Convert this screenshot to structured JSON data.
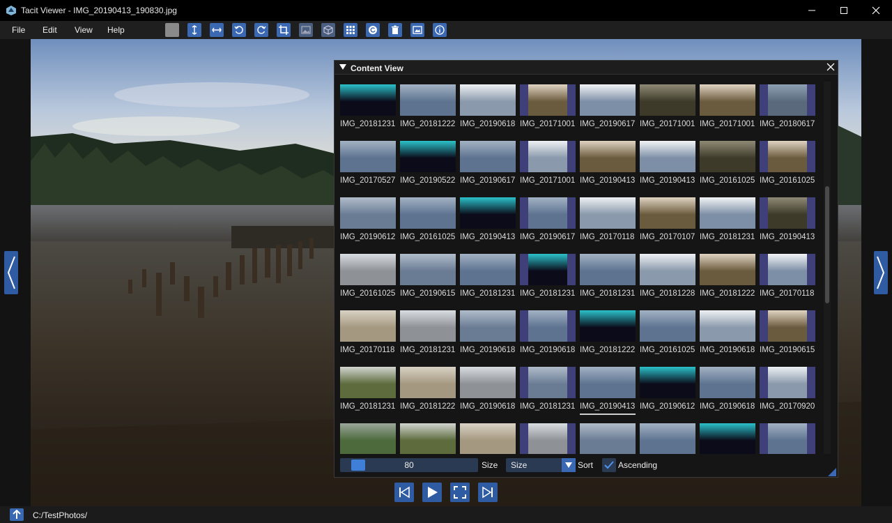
{
  "window": {
    "title": "Tacit Viewer - IMG_20190413_190830.jpg",
    "minimize_icon": "minimize-icon",
    "maximize_icon": "maximize-icon",
    "close_icon": "close-icon"
  },
  "menu": {
    "items": [
      "File",
      "Edit",
      "View",
      "Help"
    ]
  },
  "toolbar": {
    "buttons": [
      "background-color",
      "fit-height",
      "fit-width",
      "rotate-left",
      "rotate-right",
      "crop",
      "image",
      "cube",
      "grid",
      "reset",
      "delete",
      "desktop-image",
      "info"
    ]
  },
  "content_view": {
    "title": "Content View",
    "items": [
      "IMG_20181231",
      "IMG_20181222",
      "IMG_20190618",
      "IMG_20171001",
      "IMG_20190617",
      "IMG_20171001",
      "IMG_20171001",
      "IMG_20180617",
      "IMG_20170527",
      "IMG_20190522",
      "IMG_20190617",
      "IMG_20171001",
      "IMG_20190413",
      "IMG_20190413",
      "IMG_20161025",
      "IMG_20161025",
      "IMG_20190612",
      "IMG_20161025",
      "IMG_20190413",
      "IMG_20190617",
      "IMG_20170118",
      "IMG_20170107",
      "IMG_20181231",
      "IMG_20190413",
      "IMG_20161025",
      "IMG_20190615",
      "IMG_20181231",
      "IMG_20181231",
      "IMG_20181231",
      "IMG_20181228",
      "IMG_20181222",
      "IMG_20170118",
      "IMG_20170118",
      "IMG_20181231",
      "IMG_20190618",
      "IMG_20190618",
      "IMG_20181222",
      "IMG_20161025",
      "IMG_20190618",
      "IMG_20190615",
      "IMG_20181231",
      "IMG_20181222",
      "IMG_20190618",
      "IMG_20181231",
      "IMG_20190413",
      "IMG_20190612",
      "IMG_20190618",
      "IMG_20170920",
      "",
      "",
      "",
      "",
      "",
      "",
      "",
      ""
    ],
    "selected_index": 44,
    "size_value": "80",
    "size_label": "Size",
    "sort_value": "Size",
    "sort_label": "Sort",
    "ascending_label": "Ascending",
    "ascending_checked": true
  },
  "playback": {
    "buttons": [
      "skip-start",
      "play",
      "fullscreen",
      "skip-end"
    ]
  },
  "status": {
    "path": "C:/TestPhotos/"
  }
}
